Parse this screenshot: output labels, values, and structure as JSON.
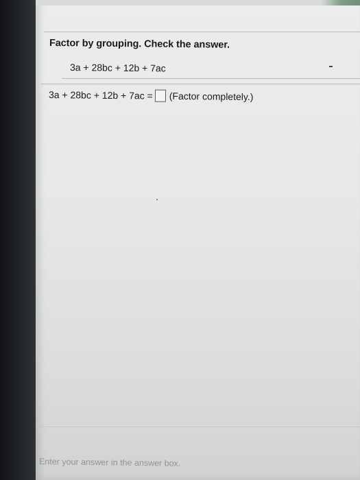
{
  "question": {
    "title": "Factor by grouping. Check the answer.",
    "expression": "3a + 28bc + 12b + 7ac",
    "answer_lhs": "3a + 28bc + 12b + 7ac =",
    "answer_value": "",
    "answer_hint": "(Factor completely.)"
  },
  "footer": {
    "hint": "Enter your answer in the answer box."
  }
}
